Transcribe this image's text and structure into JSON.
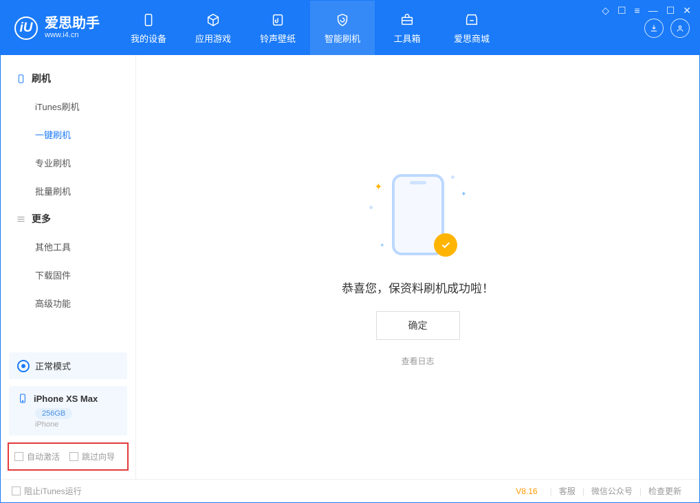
{
  "app": {
    "name_cn": "爱思助手",
    "name_en": "www.i4.cn",
    "logo_letter": "iU"
  },
  "window_controls": {
    "pin": "◇",
    "skin": "☐",
    "menu": "≡",
    "min": "—",
    "max": "☐",
    "close": "✕"
  },
  "tabs": {
    "device": "我的设备",
    "apps": "应用游戏",
    "ringtones": "铃声壁纸",
    "flash": "智能刷机",
    "tools": "工具箱",
    "store": "爱思商城"
  },
  "sidebar": {
    "flash_group": "刷机",
    "items_flash": [
      "iTunes刷机",
      "一键刷机",
      "专业刷机",
      "批量刷机"
    ],
    "more_group": "更多",
    "items_more": [
      "其他工具",
      "下载固件",
      "高级功能"
    ],
    "mode_label": "正常模式",
    "device_name": "iPhone XS Max",
    "device_capacity": "256GB",
    "device_type": "iPhone",
    "checkbox_auto_activate": "自动激活",
    "checkbox_skip_guide": "跳过向导"
  },
  "main": {
    "success_message": "恭喜您，保资料刷机成功啦！",
    "confirm_button": "确定",
    "view_log": "查看日志"
  },
  "footer": {
    "block_itunes": "阻止iTunes运行",
    "version": "V8.16",
    "support": "客服",
    "wechat": "微信公众号",
    "update": "检查更新"
  }
}
